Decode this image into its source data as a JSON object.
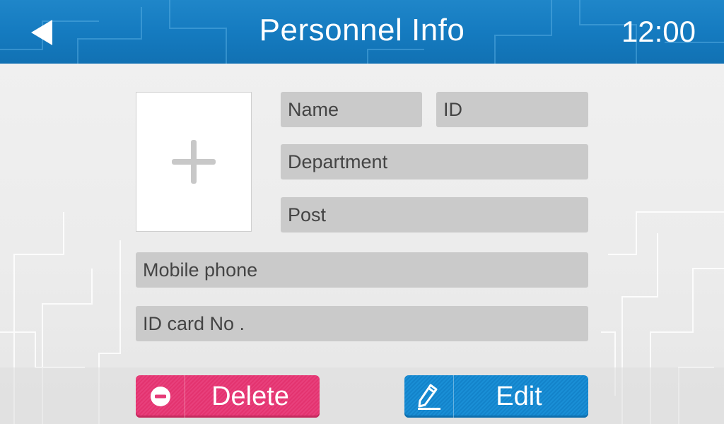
{
  "header": {
    "title": "Personnel Info",
    "time": "12:00"
  },
  "form": {
    "photo_icon": "plus-icon",
    "name_placeholder": "Name",
    "id_placeholder": "ID",
    "department_placeholder": "Department",
    "post_placeholder": "Post",
    "mobile_placeholder": "Mobile phone",
    "id_card_placeholder": "ID card No ."
  },
  "actions": {
    "delete_label": "Delete",
    "edit_label": "Edit"
  },
  "colors": {
    "header": "#1679bd",
    "delete": "#e63a77",
    "edit": "#178ad0",
    "field": "#cacaca"
  }
}
